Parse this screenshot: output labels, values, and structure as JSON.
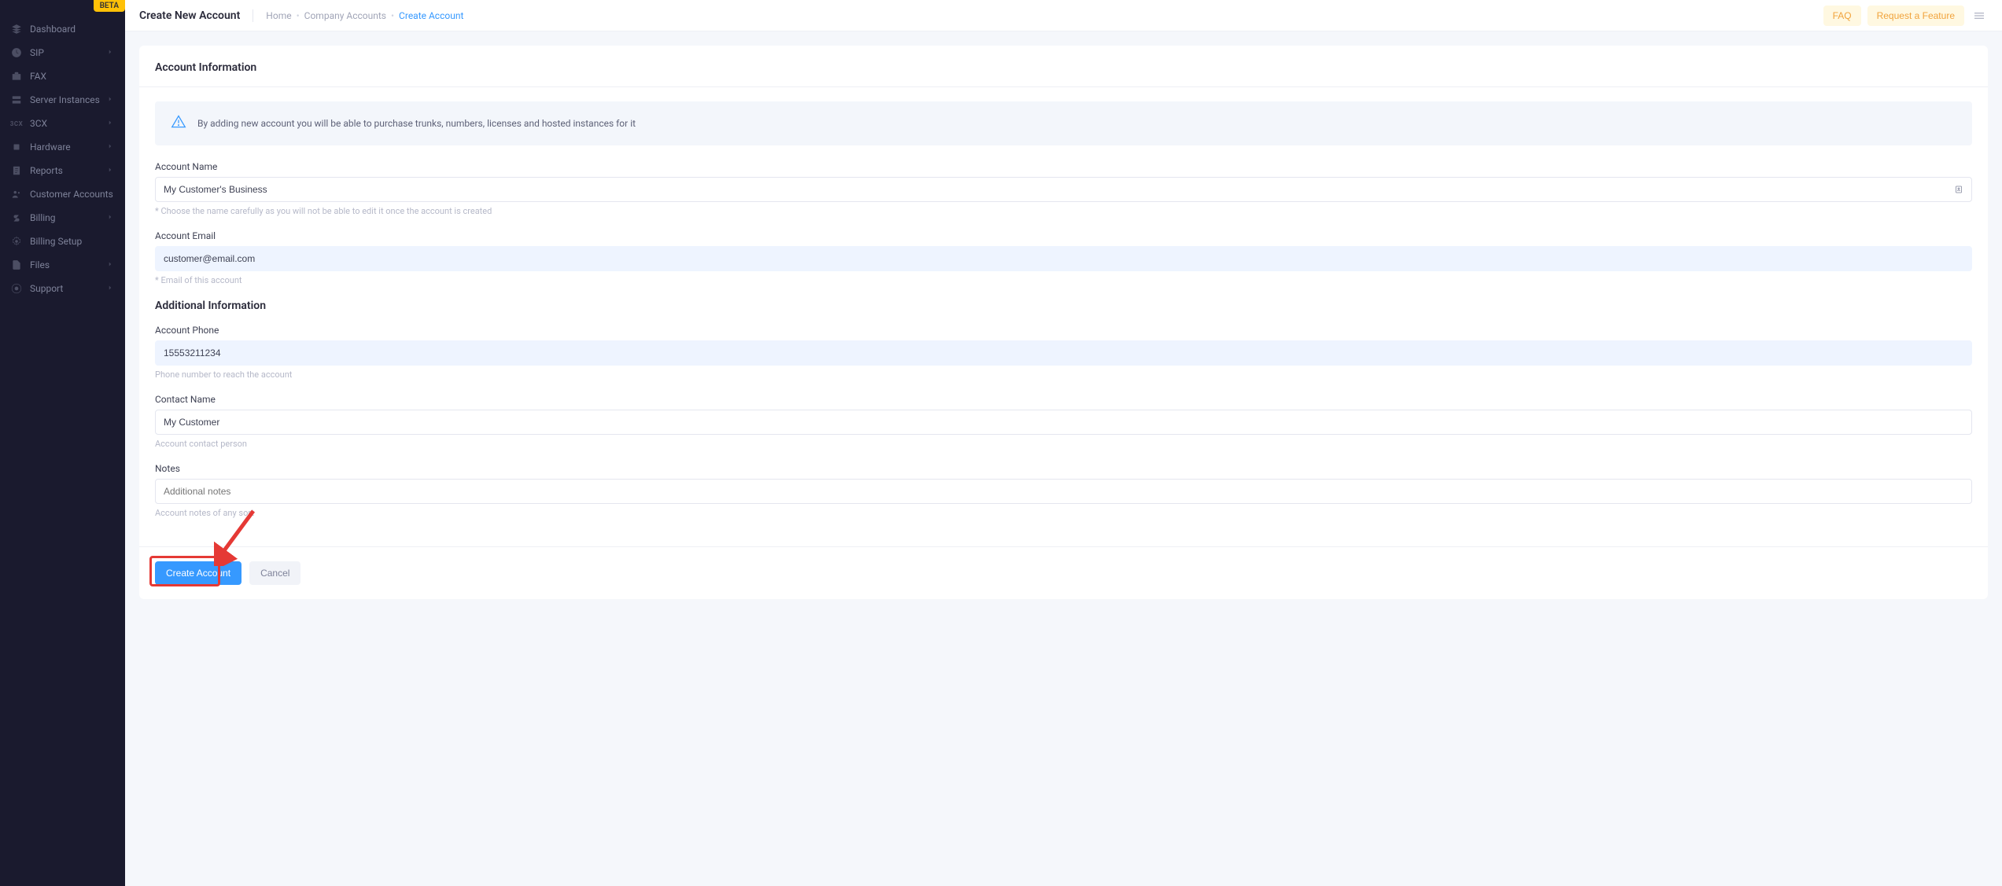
{
  "badge": "BETA",
  "sidebar": {
    "items": [
      {
        "label": "Dashboard",
        "icon": "layers",
        "chevron": false
      },
      {
        "label": "SIP",
        "icon": "clock",
        "chevron": true
      },
      {
        "label": "FAX",
        "icon": "briefcase",
        "chevron": false
      },
      {
        "label": "Server Instances",
        "icon": "server",
        "chevron": true
      },
      {
        "label": "3CX",
        "icon": "3cx-text",
        "chevron": true
      },
      {
        "label": "Hardware",
        "icon": "chip",
        "chevron": true
      },
      {
        "label": "Reports",
        "icon": "report",
        "chevron": true
      },
      {
        "label": "Customer Accounts",
        "icon": "users",
        "chevron": false
      },
      {
        "label": "Billing",
        "icon": "dollar",
        "chevron": true
      },
      {
        "label": "Billing Setup",
        "icon": "gear",
        "chevron": false
      },
      {
        "label": "Files",
        "icon": "file",
        "chevron": true
      },
      {
        "label": "Support",
        "icon": "support",
        "chevron": true
      }
    ]
  },
  "header": {
    "title": "Create New Account",
    "breadcrumbs": [
      "Home",
      "Company Accounts",
      "Create Account"
    ],
    "faq": "FAQ",
    "request_feature": "Request a Feature"
  },
  "card": {
    "section1_title": "Account Information",
    "info_text": "By adding new account you will be able to purchase trunks, numbers, licenses and hosted instances for it",
    "account_name_label": "Account Name",
    "account_name_value": "My Customer's Business",
    "account_name_hint": "* Choose the name carefully as you will not be able to edit it once the account is created",
    "account_email_label": "Account Email",
    "account_email_value": "customer@email.com",
    "account_email_hint": "* Email of this account",
    "section2_title": "Additional Information",
    "phone_label": "Account Phone",
    "phone_value": "15553211234",
    "phone_hint": "Phone number to reach the account",
    "contact_label": "Contact Name",
    "contact_value": "My Customer",
    "contact_hint": "Account contact person",
    "notes_label": "Notes",
    "notes_placeholder": "Additional notes",
    "notes_hint": "Account notes of any sort",
    "create_btn": "Create Account",
    "cancel_btn": "Cancel"
  }
}
